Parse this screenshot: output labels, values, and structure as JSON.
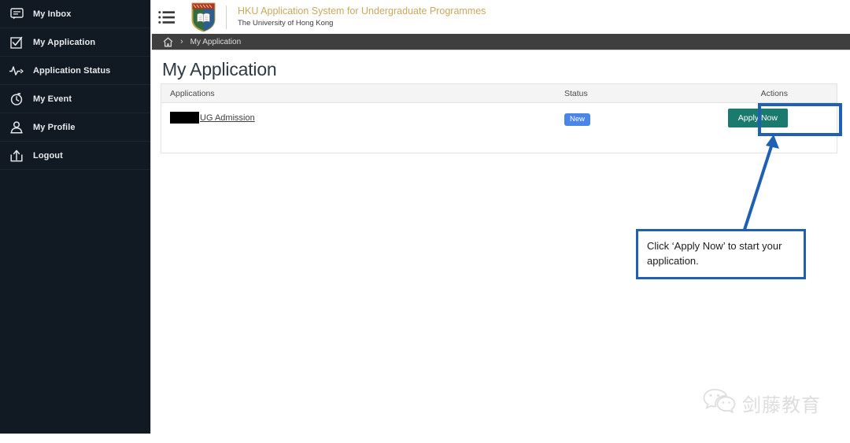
{
  "sidebar": {
    "items": [
      {
        "label": "My Inbox",
        "icon": "inbox-message-icon"
      },
      {
        "label": "My Application",
        "icon": "checkbox-check-icon"
      },
      {
        "label": "Application Status",
        "icon": "activity-pulse-icon"
      },
      {
        "label": "My Event",
        "icon": "clock-icon"
      },
      {
        "label": "My Profile",
        "icon": "person-icon"
      },
      {
        "label": "Logout",
        "icon": "logout-share-icon"
      }
    ]
  },
  "header": {
    "menu_icon": "hamburger-list-icon",
    "logo_icon": "hku-crest-icon",
    "title": "HKU Application System for Undergraduate Programmes",
    "subtitle": "The University of Hong Kong",
    "title_color": "#c9a85c"
  },
  "breadcrumb": {
    "home_icon": "home-icon",
    "separator": "›",
    "current": "My Application"
  },
  "main": {
    "page_title": "My Application",
    "table": {
      "columns": [
        "Applications",
        "Status",
        "Actions"
      ],
      "rows": [
        {
          "application": "UG Admission",
          "redacted": true,
          "status": "New",
          "status_color": "#4a86e8",
          "action_label": "Apply Now",
          "action_color": "#1a7a6d"
        }
      ]
    }
  },
  "annotation": {
    "highlight_color": "#1f5fb4",
    "callout_text": "Click ‘Apply Now’ to start your application.",
    "arrow_icon": "arrow-pointer-icon"
  },
  "watermark": {
    "icon": "wechat-icon",
    "text": "剑藤教育"
  }
}
